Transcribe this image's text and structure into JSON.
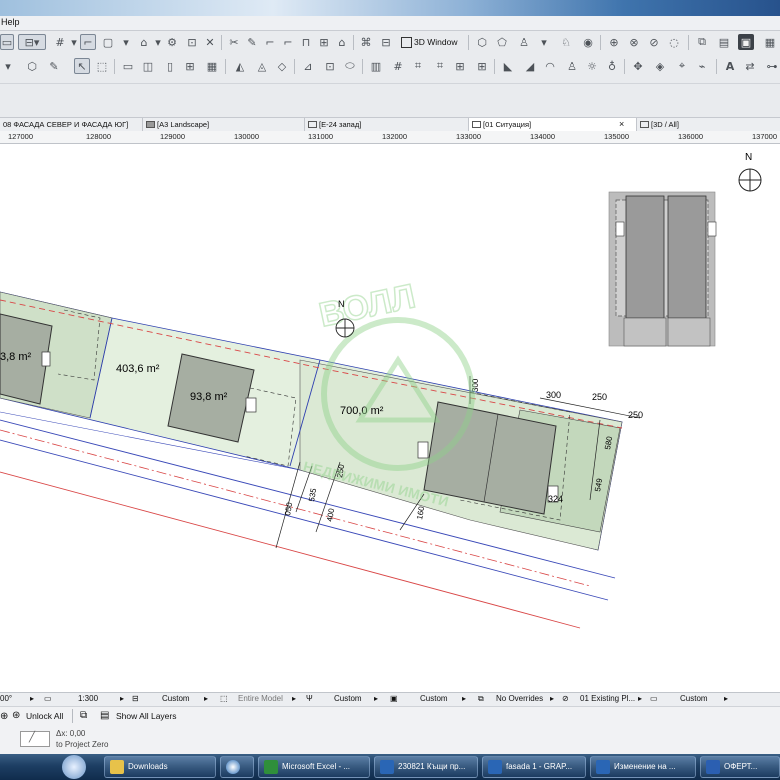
{
  "menubar": {
    "help_label": "Help"
  },
  "toolbar_top": {
    "view3d_label": "3D Window"
  },
  "tabs": [
    {
      "label": "08 ФАСАДА СЕВЕР  И ФАСАДА ЮГ]"
    },
    {
      "label": "[A3 Landscape]"
    },
    {
      "label": "[E-24 запад]"
    },
    {
      "label": "[01 Ситуация]",
      "active": true,
      "close_glyph": "×"
    },
    {
      "label": "[3D / All]"
    }
  ],
  "ruler": {
    "ticks": [
      "127000",
      "128000",
      "129000",
      "130000",
      "131000",
      "132000",
      "133000",
      "134000",
      "135000",
      "136000",
      "137000"
    ]
  },
  "drawing": {
    "north_label": "N",
    "north_label_plan": "N",
    "areas": [
      "3,8 m²",
      "403,6 m²",
      "93,8 m²",
      "700,0 m²"
    ],
    "dimensions": [
      "300",
      "250",
      "250",
      "300",
      "580",
      "549",
      "324",
      "250",
      "535",
      "400",
      "050",
      "160"
    ],
    "watermark_top": "ВОЛЛ",
    "watermark_bottom": "НЕДВИЖИМИ ИМОТИ"
  },
  "bottombar": {
    "zoom": "00°",
    "scale": "1:300",
    "custom1": "Custom",
    "entire_model": "Entire Model",
    "custom2": "Custom",
    "custom3": "Custom",
    "overrides": "No Overrides",
    "layer_combo": "01 Existing Pl...",
    "custom4": "Custom"
  },
  "cmdbar": {
    "unlock_all": "Unlock All",
    "show_all_layers": "Show All Layers",
    "dx_value": "Δx: 0,00",
    "to_project_zero": "to Project Zero"
  },
  "taskbar": {
    "items": [
      "Downloads",
      "Microsoft Excel - ...",
      "230821 Къщи пр...",
      "fasada 1 - GRAP...",
      "Изменение на ...",
      "ОФЕРТ..."
    ]
  },
  "colors": {
    "building_fill": "#a6aea2",
    "plot_fill": "#e4f0df",
    "watermark": "#8fd18a",
    "accent_red": "#d94747",
    "accent_blue": "#3a49b8"
  }
}
